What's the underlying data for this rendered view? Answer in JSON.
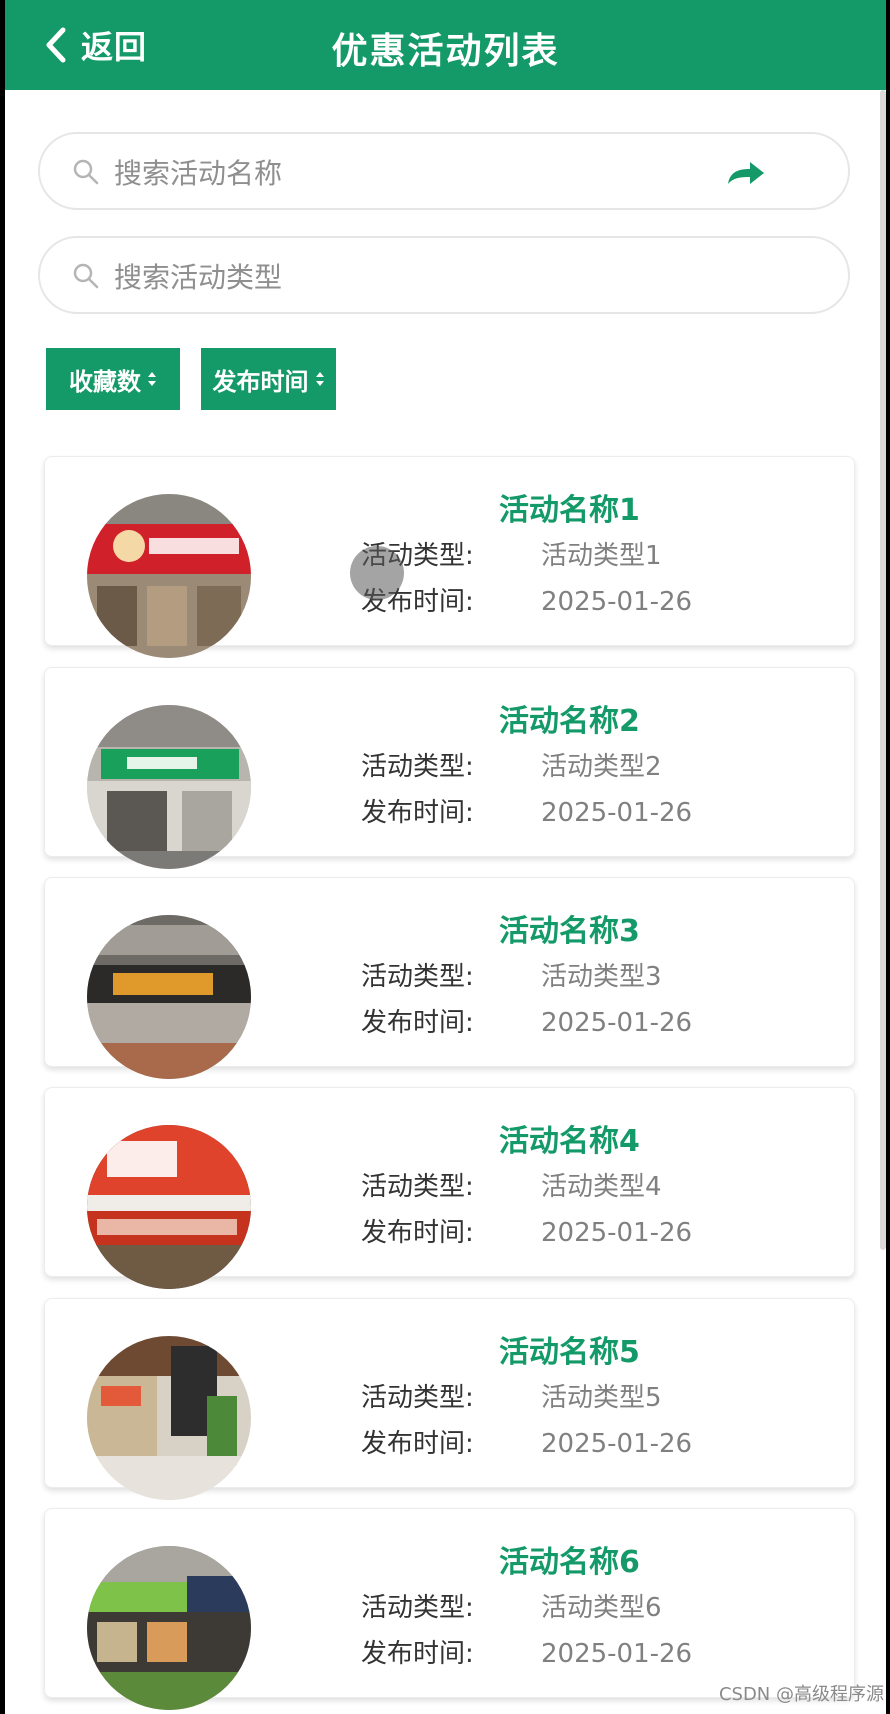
{
  "header": {
    "back_label": "返回",
    "title": "优惠活动列表"
  },
  "search": {
    "name_placeholder": "搜索活动名称",
    "type_placeholder": "搜索活动类型"
  },
  "sort": {
    "favorites_label": "收藏数",
    "publish_time_label": "发布时间"
  },
  "labels": {
    "type": "活动类型:",
    "time": "发布时间:"
  },
  "activities": [
    {
      "name": "活动名称1",
      "type": "活动类型1",
      "time": "2025-01-26"
    },
    {
      "name": "活动名称2",
      "type": "活动类型2",
      "time": "2025-01-26"
    },
    {
      "name": "活动名称3",
      "type": "活动类型3",
      "time": "2025-01-26"
    },
    {
      "name": "活动名称4",
      "type": "活动类型4",
      "time": "2025-01-26"
    },
    {
      "name": "活动名称5",
      "type": "活动类型5",
      "time": "2025-01-26"
    },
    {
      "name": "活动名称6",
      "type": "活动类型6",
      "time": "2025-01-26"
    }
  ],
  "watermark": "CSDN @高级程序源",
  "colors": {
    "primary": "#149a68",
    "text": "#333333",
    "muted": "#808080"
  },
  "icons": {
    "back": "chevron-left-icon",
    "search": "search-icon",
    "go": "arrow-right-icon",
    "sort": "sort-arrows-icon"
  }
}
